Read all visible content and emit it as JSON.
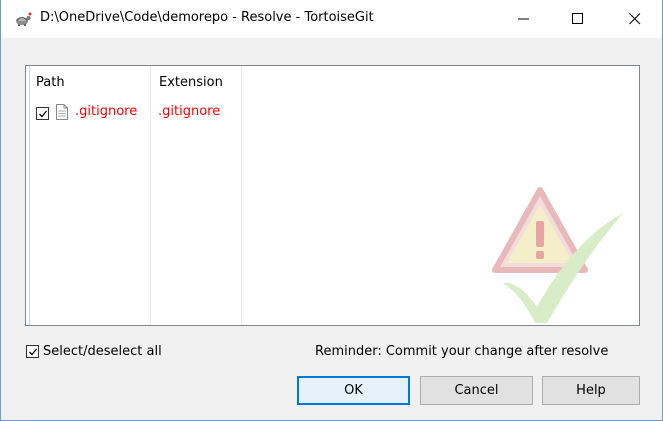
{
  "window": {
    "title": "D:\\OneDrive\\Code\\demorepo - Resolve - TortoiseGit",
    "icon": "tortoise-icon"
  },
  "list": {
    "columns": [
      "Path",
      "Extension"
    ],
    "rows": [
      {
        "checked": true,
        "path": ".gitignore",
        "extension": ".gitignore",
        "icon": "file-icon",
        "color": "#ff0000"
      }
    ]
  },
  "footer": {
    "select_all_label": "Select/deselect all",
    "select_all_checked": true,
    "reminder": "Reminder: Commit your change after resolve"
  },
  "buttons": {
    "ok": "OK",
    "cancel": "Cancel",
    "help": "Help"
  },
  "colors": {
    "accent": "#0078d7",
    "conflict_text": "#ff0000"
  }
}
